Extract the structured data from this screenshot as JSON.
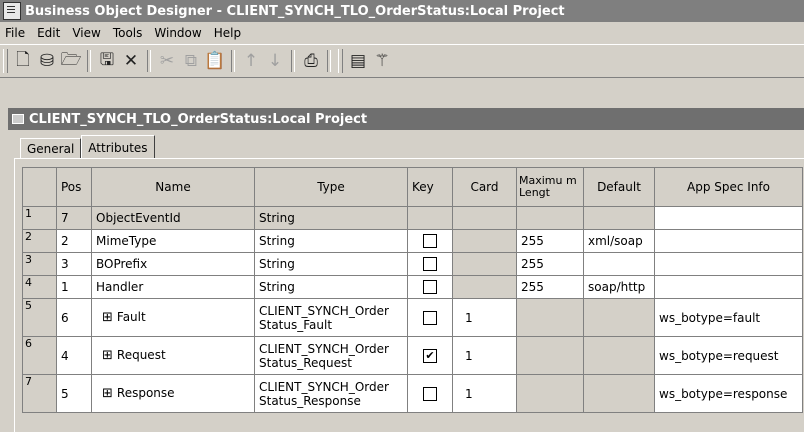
{
  "window": {
    "title": "Business Object Designer - CLIENT_SYNCH_TLO_OrderStatus:Local Project"
  },
  "menu": [
    "File",
    "Edit",
    "View",
    "Tools",
    "Window",
    "Help"
  ],
  "toolbar": {
    "new_icon": "new-file-icon",
    "open_icon": "open-folder-icon",
    "folder_icon": "folder-icon",
    "save_icon": "save-icon",
    "delete_icon": "delete-icon",
    "cut_icon": "cut-icon",
    "copy_icon": "copy-icon",
    "paste_icon": "paste-icon",
    "up_icon": "move-up-icon",
    "down_icon": "move-down-icon",
    "print_icon": "print-icon",
    "doc_icon": "document-icon",
    "wand_icon": "wand-icon"
  },
  "frame": {
    "title": "CLIENT_SYNCH_TLO_OrderStatus:Local Project"
  },
  "tabs": {
    "general": "General",
    "attributes": "Attributes"
  },
  "columns": {
    "pos": "Pos",
    "name": "Name",
    "type": "Type",
    "key": "Key",
    "card": "Card",
    "maxlen": "Maximu m Lengt",
    "default": "Default",
    "appspec": "App Spec Info"
  },
  "rows": [
    {
      "num": "1",
      "pos": "7",
      "name": "ObjectEventId",
      "type": "String",
      "key": false,
      "card": "",
      "maxlen": "",
      "default": "",
      "appspec": ""
    },
    {
      "num": "2",
      "pos": "2",
      "name": "MimeType",
      "type": "String",
      "key": false,
      "card": "",
      "maxlen": "255",
      "default": "xml/soap",
      "appspec": ""
    },
    {
      "num": "3",
      "pos": "3",
      "name": "BOPrefix",
      "type": "String",
      "key": false,
      "card": "",
      "maxlen": "255",
      "default": "",
      "appspec": ""
    },
    {
      "num": "4",
      "pos": "1",
      "name": "Handler",
      "type": "String",
      "key": false,
      "card": "",
      "maxlen": "255",
      "default": "soap/http",
      "appspec": ""
    },
    {
      "num": "5",
      "pos": "6",
      "name": "Fault",
      "type": "CLIENT_SYNCH_Order Status_Fault",
      "key": false,
      "card": "1",
      "maxlen": "",
      "default": "",
      "appspec": "ws_botype=fault"
    },
    {
      "num": "6",
      "pos": "4",
      "name": "Request",
      "type": "CLIENT_SYNCH_Order Status_Request",
      "key": true,
      "card": "1",
      "maxlen": "",
      "default": "",
      "appspec": "ws_botype=request"
    },
    {
      "num": "7",
      "pos": "5",
      "name": "Response",
      "type": "CLIENT_SYNCH_Order Status_Response",
      "key": false,
      "card": "1",
      "maxlen": "",
      "default": "",
      "appspec": "ws_botype=response"
    }
  ],
  "expand_glyph": "⊞",
  "check_glyph": "✔"
}
